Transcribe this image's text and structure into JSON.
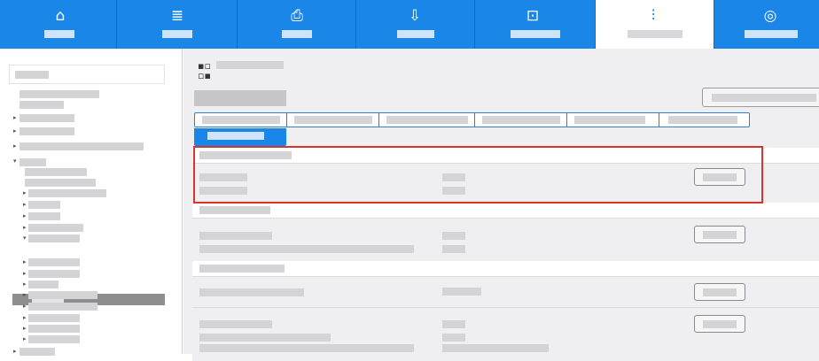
{
  "app": {
    "accent": "#1a86e8",
    "highlight_color": "#d9342b"
  },
  "nav": {
    "items": [
      {
        "icon": "home-icon",
        "glyph": "⌂",
        "active": false
      },
      {
        "icon": "stack-icon",
        "glyph": "≣",
        "active": false
      },
      {
        "icon": "printer-icon",
        "glyph": "⎙",
        "active": false
      },
      {
        "icon": "download-icon",
        "glyph": "⇩",
        "active": false
      },
      {
        "icon": "device-icon",
        "glyph": "⊡",
        "active": false
      },
      {
        "icon": "sliders-icon",
        "glyph": "⫶",
        "active": true
      },
      {
        "icon": "lifebuoy-icon",
        "glyph": "◎",
        "active": false
      }
    ]
  }
}
